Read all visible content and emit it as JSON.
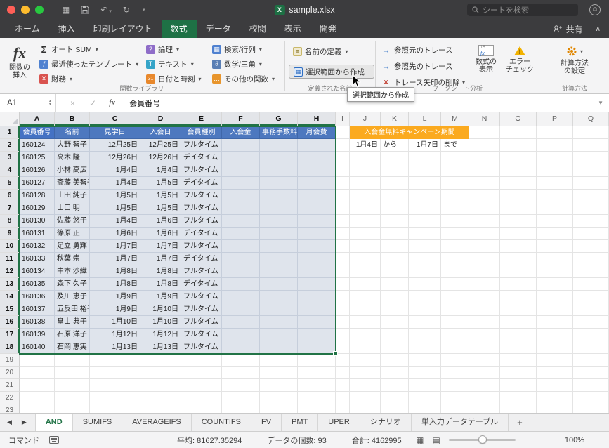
{
  "titlebar": {
    "title": "sample.xlsx",
    "search_placeholder": "シートを検索"
  },
  "tabs": {
    "items": [
      "ホーム",
      "挿入",
      "印刷レイアウト",
      "数式",
      "データ",
      "校閲",
      "表示",
      "開発"
    ],
    "active_index": 3,
    "share": "共有"
  },
  "ribbon": {
    "groups": {
      "function_library": {
        "label": "関数ライブラリ",
        "insert_l1": "関数の",
        "insert_l2": "挿入",
        "buttons": [
          {
            "label": "オート SUM"
          },
          {
            "label": "最近使ったテンプレート"
          },
          {
            "label": "財務"
          },
          {
            "label": "論理"
          },
          {
            "label": "テキスト"
          },
          {
            "label": "日付と時刻"
          },
          {
            "label": "検索/行列"
          },
          {
            "label": "数学/三角"
          },
          {
            "label": "その他の関数"
          }
        ]
      },
      "defined_names": {
        "label": "定義された名前",
        "define_name": "名前の定義",
        "create_from_selection": "選択範囲から作成"
      },
      "worksheet_analysis": {
        "label": "ワークシート分析",
        "trace_precedents": "参照元のトレース",
        "trace_dependents": "参照先のトレース",
        "remove_arrows": "トレース矢印の削除",
        "show_formulas_l1": "数式の",
        "show_formulas_l2": "表示",
        "error_l1": "エラー",
        "error_l2": "チェック"
      },
      "calculation": {
        "label": "計算方法",
        "options_l1": "計算方法",
        "options_l2": "の設定"
      }
    },
    "tooltip": "選択範囲から作成"
  },
  "formula_bar": {
    "cell_ref": "A1",
    "content": "会員番号"
  },
  "sheet": {
    "columns": [
      "A",
      "B",
      "C",
      "D",
      "E",
      "F",
      "G",
      "H",
      "I",
      "J",
      "K",
      "L",
      "M",
      "N",
      "O",
      "P",
      "Q"
    ],
    "table": {
      "headers": [
        "会員番号",
        "名前",
        "見学日",
        "入会日",
        "会員種別",
        "入会金",
        "事務手数料",
        "月会費"
      ],
      "rows": [
        [
          "160124",
          "大野 智子",
          "12月25日",
          "12月25日",
          "フルタイム"
        ],
        [
          "160125",
          "高木 隆",
          "12月26日",
          "12月26日",
          "デイタイム"
        ],
        [
          "160126",
          "小林 高広",
          "1月4日",
          "1月4日",
          "フルタイム"
        ],
        [
          "160127",
          "斎藤 美智子",
          "1月4日",
          "1月5日",
          "デイタイム"
        ],
        [
          "160128",
          "山田 純子",
          "1月5日",
          "1月5日",
          "フルタイム"
        ],
        [
          "160129",
          "山口 明",
          "1月5日",
          "1月5日",
          "フルタイム"
        ],
        [
          "160130",
          "佐藤 悠子",
          "1月4日",
          "1月6日",
          "フルタイム"
        ],
        [
          "160131",
          "篠原 正",
          "1月6日",
          "1月6日",
          "デイタイム"
        ],
        [
          "160132",
          "足立 勇輝",
          "1月7日",
          "1月7日",
          "フルタイム"
        ],
        [
          "160133",
          "秋葉 崇",
          "1月7日",
          "1月7日",
          "デイタイム"
        ],
        [
          "160134",
          "中本 沙織",
          "1月8日",
          "1月8日",
          "フルタイム"
        ],
        [
          "160135",
          "森下 久子",
          "1月8日",
          "1月8日",
          "デイタイム"
        ],
        [
          "160136",
          "及川 恵子",
          "1月9日",
          "1月9日",
          "フルタイム"
        ],
        [
          "160137",
          "五反田 裕子",
          "1月9日",
          "1月10日",
          "フルタイム"
        ],
        [
          "160138",
          "畠山 典子",
          "1月10日",
          "1月10日",
          "フルタイム"
        ],
        [
          "160139",
          "石原 洋子",
          "1月12日",
          "1月12日",
          "フルタイム"
        ],
        [
          "160140",
          "石岡 恵実",
          "1月13日",
          "1月13日",
          "フルタイム"
        ]
      ]
    },
    "campaign": {
      "title": "入会金無料キャンペーン期間",
      "from": "1月4日",
      "from_word": "から",
      "to": "1月7日",
      "to_word": "まで"
    }
  },
  "sheet_tabs": {
    "items": [
      "AND",
      "SUMIFS",
      "AVERAGEIFS",
      "COUNTIFS",
      "FV",
      "PMT",
      "UPER",
      "シナリオ",
      "単入力データテーブル"
    ],
    "active_index": 0,
    "add": "+"
  },
  "status_bar": {
    "mode": "コマンド",
    "average": "平均: 81627.35294",
    "count": "データの個数: 93",
    "sum": "合計: 4162995",
    "zoom": "100%"
  },
  "icons": {
    "fx": "fx",
    "autosum": "Σ",
    "recent": "ƒ",
    "financial": "¥",
    "logical": "?",
    "text": "T",
    "datetime": "31",
    "lookup": "▦",
    "math": "θ",
    "more": "…",
    "define_name": "≡",
    "create_from_selection": "▦",
    "trace": "→",
    "remove_arrows": "×",
    "caret": "▾",
    "close": "×",
    "check": "✓",
    "formulas_15": "15",
    "formulas_fx": "fx",
    "warning_mark": "!",
    "dropdown": "▼",
    "stepper_up": "▴",
    "stepper_down": "▾",
    "undo": "↶",
    "redo": "↻",
    "toolbar_grid": "▦",
    "collapse": "∧",
    "smiley": "☺",
    "prev": "◀",
    "next": "▶",
    "grid_view": "▦",
    "page_view": "▤",
    "excel_logo": "X"
  },
  "colors": {
    "accent_green": "#217346",
    "table_header_blue": "#4472c4",
    "campaign_orange": "#fbaa1f",
    "selection_tint": "#dfe4ec"
  }
}
